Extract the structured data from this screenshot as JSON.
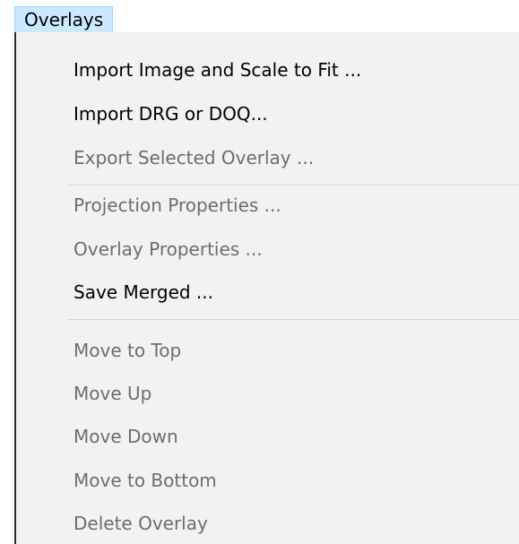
{
  "menubar": {
    "title": "Overlays"
  },
  "menu": {
    "items": [
      {
        "label": "Import Image and Scale to Fit ...",
        "enabled": true
      },
      {
        "label": "Import DRG or DOQ...",
        "enabled": true
      },
      {
        "label": "Export Selected Overlay ...",
        "enabled": false
      },
      {
        "label": "Projection Properties ...",
        "enabled": false
      },
      {
        "label": "Overlay Properties ...",
        "enabled": false
      },
      {
        "label": "Save Merged ...",
        "enabled": true
      },
      {
        "label": "Move to Top",
        "enabled": false
      },
      {
        "label": "Move Up",
        "enabled": false
      },
      {
        "label": "Move Down",
        "enabled": false
      },
      {
        "label": "Move to Bottom",
        "enabled": false
      },
      {
        "label": "Delete Overlay",
        "enabled": false
      }
    ]
  },
  "colors": {
    "menubar_highlight": "#cce8ff",
    "menu_background": "#f2f2f2",
    "disabled_text": "#6d6d6d",
    "enabled_text": "#000000"
  }
}
